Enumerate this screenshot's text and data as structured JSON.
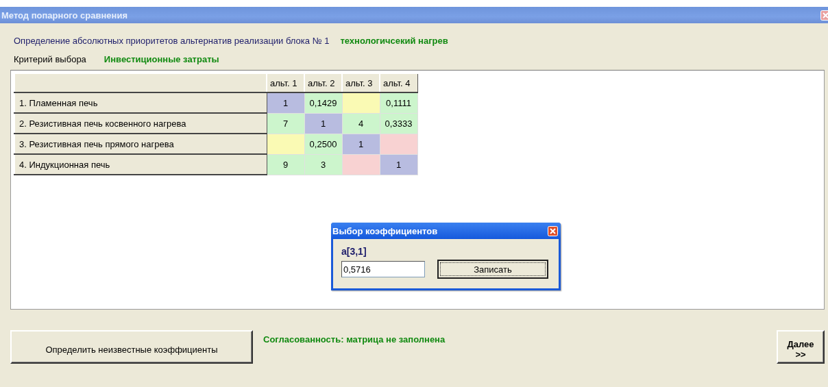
{
  "window": {
    "title": "Метод попарного сравнения"
  },
  "header": {
    "block_label": "Определение абсолютных приоритетов альтернатив реализации блока № 1",
    "block_name": "технологичсекий нагрев"
  },
  "criterion": {
    "label": "Критерий выбора",
    "value": "Инвестиционные затраты"
  },
  "table": {
    "columns": [
      "альт. 1",
      "альт. 2",
      "альт. 3",
      "альт. 4"
    ],
    "rows": [
      {
        "name": "1. Пламенная печь",
        "cells": [
          {
            "value": "1",
            "color": "#b8bce0"
          },
          {
            "value": "0,1429",
            "color": "#ccf5cc"
          },
          {
            "color": "#fafab4"
          },
          {
            "value": "0,1111",
            "color": "#ccf5cc"
          }
        ]
      },
      {
        "name": "2. Резистивная печь косвенного нагрева",
        "cells": [
          {
            "value": "7",
            "color": "#ccf5cc"
          },
          {
            "value": "1",
            "color": "#b8bce0"
          },
          {
            "value": "4",
            "color": "#ccf5cc"
          },
          {
            "value": "0,3333",
            "color": "#ccf5cc"
          }
        ]
      },
      {
        "name": "3. Резистивная печь прямого нагрева",
        "cells": [
          {
            "color": "#fafab4"
          },
          {
            "value": "0,2500",
            "color": "#ccf5cc"
          },
          {
            "value": "1",
            "color": "#b8bce0"
          },
          {
            "color": "#f8d2d2"
          }
        ]
      },
      {
        "name": "4. Индукционная печь",
        "cells": [
          {
            "value": "9",
            "color": "#ccf5cc"
          },
          {
            "value": "3",
            "color": "#ccf5cc"
          },
          {
            "color": "#f8d2d2"
          },
          {
            "value": "1",
            "color": "#b8bce0"
          }
        ]
      }
    ]
  },
  "dialog": {
    "title": "Выбор коэффициентов",
    "label": "a[3,1]",
    "value": "0,5716",
    "button": "Записать"
  },
  "footer": {
    "left_button": "Определить неизвестные коэффициенты",
    "status": "Согласованность: матрица не заполнена",
    "next_button": "Далее >>"
  }
}
